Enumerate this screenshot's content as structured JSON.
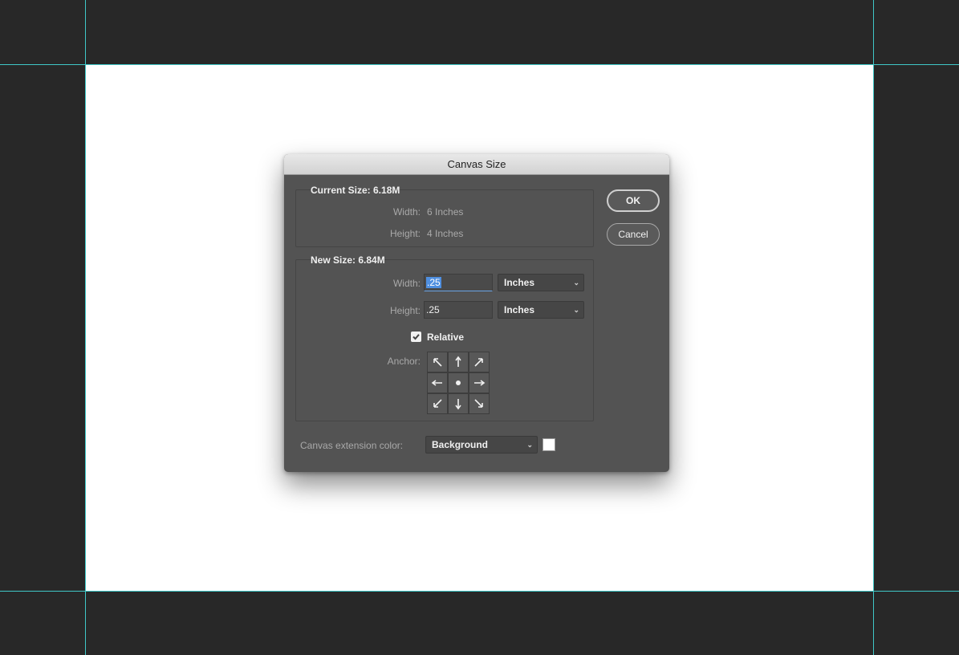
{
  "dialog": {
    "title": "Canvas Size",
    "current_size": {
      "label": "Current Size: 6.18M",
      "width_label": "Width:",
      "width_value": "6 Inches",
      "height_label": "Height:",
      "height_value": "4 Inches"
    },
    "new_size": {
      "label": "New Size: 6.84M",
      "width_label": "Width:",
      "width_value": ".25",
      "width_unit": "Inches",
      "height_label": "Height:",
      "height_value": ".25",
      "height_unit": "Inches",
      "relative_label": "Relative",
      "relative_checked": true,
      "anchor_label": "Anchor:",
      "anchor_icons": [
        "arrow-up-left-icon",
        "arrow-up-icon",
        "arrow-up-right-icon",
        "arrow-left-icon",
        "anchor-center-dot-icon",
        "arrow-right-icon",
        "arrow-down-left-icon",
        "arrow-down-icon",
        "arrow-down-right-icon"
      ]
    },
    "extension": {
      "label": "Canvas extension color:",
      "value": "Background",
      "swatch_color": "#ffffff"
    },
    "ok_label": "OK",
    "cancel_label": "Cancel"
  },
  "colors": {
    "guide": "#3fc8c8",
    "pasteboard": "#282828",
    "dialog_bg": "#535353"
  }
}
